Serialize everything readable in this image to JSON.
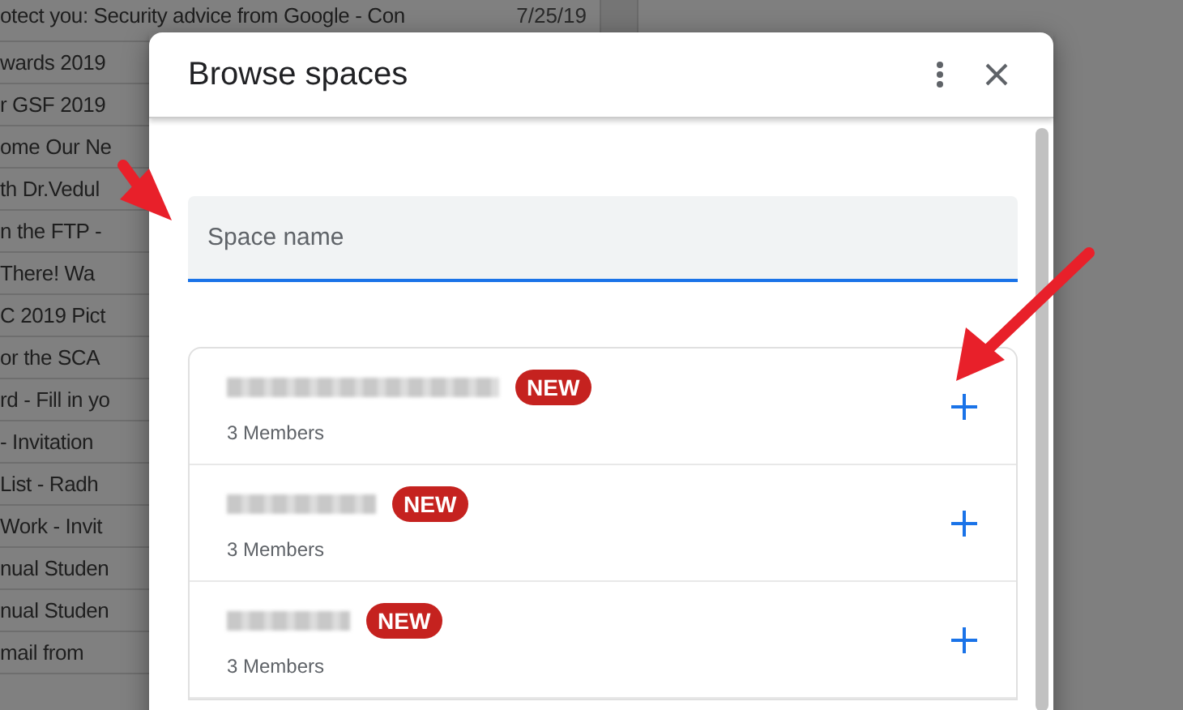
{
  "background_list": {
    "rows": [
      {
        "subject": "otect you: Security advice from Google - Con",
        "date": "7/25/19"
      },
      {
        "subject": "wards 2019"
      },
      {
        "subject": "r GSF 2019"
      },
      {
        "subject": "ome Our Ne"
      },
      {
        "subject": "th Dr.Vedul"
      },
      {
        "subject": "n the FTP -"
      },
      {
        "subject": "There! Wa"
      },
      {
        "subject": "C 2019 Pict"
      },
      {
        "subject": "or the SCA"
      },
      {
        "subject": "rd - Fill in yo"
      },
      {
        "subject": "- Invitation"
      },
      {
        "subject": "List - Radh"
      },
      {
        "subject": "Work - Invit"
      },
      {
        "subject": "nual Studen"
      },
      {
        "subject": "nual Studen"
      },
      {
        "subject": "mail from"
      }
    ]
  },
  "dialog": {
    "title": "Browse spaces",
    "search": {
      "placeholder": "Space name"
    },
    "spaces": [
      {
        "badge": "NEW",
        "members": "3 Members"
      },
      {
        "badge": "NEW",
        "members": "3 Members"
      },
      {
        "badge": "NEW",
        "members": "3 Members"
      }
    ]
  }
}
